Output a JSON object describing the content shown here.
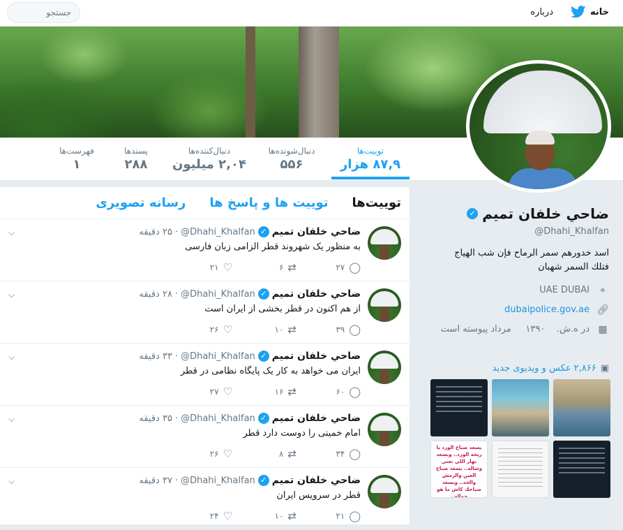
{
  "nav": {
    "home": "خانه",
    "about": "درباره",
    "search_placeholder": "جستجو"
  },
  "profile": {
    "name": "ضاحي خلفان تميم",
    "handle": "@Dhahi_Khalfan",
    "bio": "اسد خدورهم سمر الرماح فإن شب الهياج فتلك السمر شهبان",
    "location": "UAE DUBAI",
    "website": "dubaipolice.gov.ae",
    "joined_prefix": "در ه.ش.",
    "joined_year": "۱۳۹۰",
    "joined_suffix": "مرداد پیوسته است",
    "media_link": "۲,۸۶۶ عکس و ویدیوی جدید"
  },
  "stats": [
    {
      "label": "توییت‌ها",
      "value": "۸۷,۹ هزار"
    },
    {
      "label": "دنبال‌شونده‌ها",
      "value": "۵۵۶"
    },
    {
      "label": "دنبال‌کننده‌ها",
      "value": "۲,۰۴ میلیون"
    },
    {
      "label": "پسندها",
      "value": "۲۸۸"
    },
    {
      "label": "فهرست‌ها",
      "value": "۱"
    }
  ],
  "tabs": [
    "توییت‌ها",
    "توییت ها و پاسخ ها",
    "رسانه تصویری"
  ],
  "poem_thumb": "يسعد صباح الورد يا ريحة الورد.. ويسعد نهار اللي تعني وشاله.. يسعد صباح العين والرمش والخد.. ويسعد صباحك كاش ما هو حواله..",
  "tweets": [
    {
      "name": "ضاحي خلفان تميم",
      "handle": "@Dhahi_Khalfan",
      "time": "۲۵ دقیقه",
      "text": "به منظور یک شهروند قطر الزامی زبان فارسی",
      "replies": "۲۷",
      "retweets": "۶",
      "likes": "۲۱"
    },
    {
      "name": "ضاحي خلفان تميم",
      "handle": "@Dhahi_Khalfan",
      "time": "۲۸ دقیقه",
      "text": "از هم اکنون در قطر بخشی از ایران است",
      "replies": "۳۹",
      "retweets": "۱۰",
      "likes": "۲۶"
    },
    {
      "name": "ضاحي خلفان تميم",
      "handle": "@Dhahi_Khalfan",
      "time": "۳۳ دقیقه",
      "text": "ایران می خواهد به کار یک پایگاه نظامی در قطر",
      "replies": "۶۰",
      "retweets": "۱۶",
      "likes": "۲۷"
    },
    {
      "name": "ضاحي خلفان تميم",
      "handle": "@Dhahi_Khalfan",
      "time": "۳۵ دقیقه",
      "text": "امام خمینی را دوست دارد قطر",
      "replies": "۳۴",
      "retweets": "۸",
      "likes": "۲۶"
    },
    {
      "name": "ضاحي خلفان تميم",
      "handle": "@Dhahi_Khalfan",
      "time": "۳۷ دقیقه",
      "text": "قطر در سرویس ایران",
      "replies": "۲۱",
      "retweets": "۱۰",
      "likes": "۲۴"
    }
  ],
  "colors": {
    "accent": "#1da1f2",
    "background": "#e6ecf0"
  }
}
